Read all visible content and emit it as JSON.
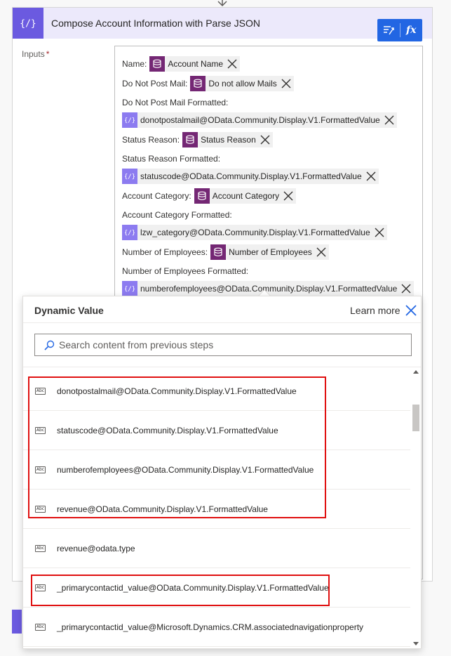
{
  "action": {
    "title": "Compose Account Information with Parse JSON",
    "inputs_label": "Inputs",
    "required_marker": "*",
    "tools": [
      "dynamic-content-icon",
      "expression-fx-icon"
    ],
    "fx_label": "fx",
    "lines": [
      {
        "label": "Name:",
        "token": {
          "text": "Account Name",
          "kind": "dataverse"
        }
      },
      {
        "label": "Do Not Post Mail:",
        "token": {
          "text": "Do not allow Mails",
          "kind": "dataverse"
        }
      },
      {
        "label": "Do Not Post Mail Formatted:"
      },
      {
        "label": "",
        "token": {
          "text": "donotpostalmail@OData.Community.Display.V1.FormattedValue",
          "kind": "compose"
        }
      },
      {
        "label": "Status Reason:",
        "token": {
          "text": "Status Reason",
          "kind": "dataverse"
        }
      },
      {
        "label": "Status Reason Formatted:"
      },
      {
        "label": "",
        "token": {
          "text": "statuscode@OData.Community.Display.V1.FormattedValue",
          "kind": "compose"
        }
      },
      {
        "label": "Account Category:",
        "token": {
          "text": "Account Category",
          "kind": "dataverse"
        }
      },
      {
        "label": "Account Category Formatted:"
      },
      {
        "label": "",
        "token": {
          "text": "lzw_category@OData.Community.Display.V1.FormattedValue",
          "kind": "compose"
        }
      },
      {
        "label": "Number of Employees:",
        "token": {
          "text": "Number of Employees",
          "kind": "dataverse"
        }
      },
      {
        "label": "Number of Employees Formatted:"
      },
      {
        "label": "",
        "token": {
          "text": "numberofemployees@OData.Community.Display.V1.FormattedValue",
          "kind": "compose"
        }
      }
    ]
  },
  "dynamic_panel": {
    "title": "Dynamic Value",
    "learn_more": "Learn more",
    "search_placeholder": "Search content from previous steps",
    "search_value": "",
    "items": [
      {
        "label": "donotpostalmail@OData.Community.Display.V1.FormattedValue",
        "icon": "text-abc-icon"
      },
      {
        "label": "statuscode@OData.Community.Display.V1.FormattedValue",
        "icon": "text-abc-icon"
      },
      {
        "label": "numberofemployees@OData.Community.Display.V1.FormattedValue",
        "icon": "text-abc-icon"
      },
      {
        "label": "revenue@OData.Community.Display.V1.FormattedValue",
        "icon": "text-abc-icon"
      },
      {
        "label": "revenue@odata.type",
        "icon": "text-abc-icon"
      },
      {
        "label": "_primarycontactid_value@OData.Community.Display.V1.FormattedValue",
        "icon": "text-abc-icon"
      },
      {
        "label": "_primarycontactid_value@Microsoft.Dynamics.CRM.associatednavigationproperty",
        "icon": "text-abc-icon"
      }
    ],
    "abc_text": "Abc"
  },
  "colors": {
    "header_bg": "#ece9fb",
    "compose_purple": "#6b5ae0",
    "dataverse_purple": "#742774",
    "tool_blue": "#2266e3",
    "highlight_red": "#e01010"
  }
}
